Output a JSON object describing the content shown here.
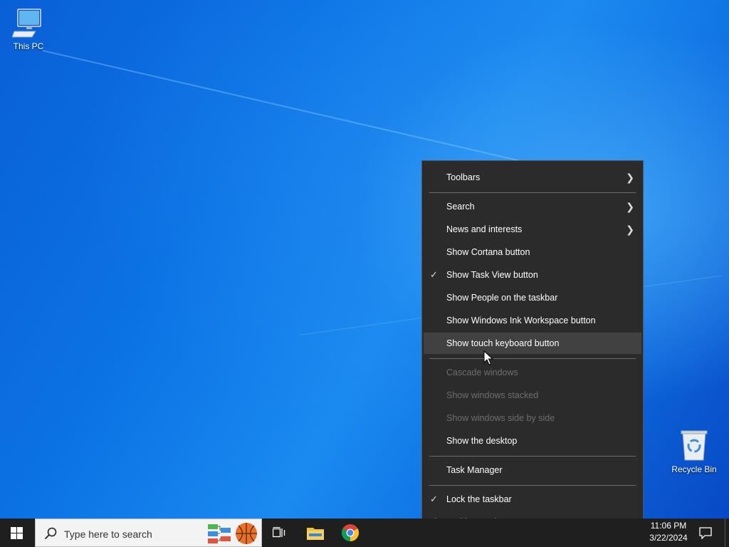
{
  "desktop": {
    "icons": [
      {
        "label": "This PC"
      },
      {
        "label": "Recycle Bin"
      }
    ]
  },
  "context_menu": {
    "items": [
      {
        "label": "Toolbars",
        "submenu": true
      },
      {
        "label": "Search",
        "submenu": true
      },
      {
        "label": "News and interests",
        "submenu": true
      },
      {
        "label": "Show Cortana button"
      },
      {
        "label": "Show Task View button",
        "checked": true
      },
      {
        "label": "Show People on the taskbar"
      },
      {
        "label": "Show Windows Ink Workspace button"
      },
      {
        "label": "Show touch keyboard button",
        "highlighted": true
      },
      {
        "label": "Cascade windows",
        "disabled": true
      },
      {
        "label": "Show windows stacked",
        "disabled": true
      },
      {
        "label": "Show windows side by side",
        "disabled": true
      },
      {
        "label": "Show the desktop"
      },
      {
        "label": "Task Manager"
      },
      {
        "label": "Lock the taskbar",
        "checked": true
      },
      {
        "label": "Taskbar settings",
        "icon": "gear-icon"
      }
    ]
  },
  "taskbar": {
    "search_placeholder": "Type here to search",
    "clock": {
      "time": "11:06 PM",
      "date": "3/22/2024"
    }
  },
  "colors": {
    "menu_bg": "#2b2b2b",
    "menu_hover": "#414141",
    "taskbar_bg": "#1f1f1f"
  }
}
